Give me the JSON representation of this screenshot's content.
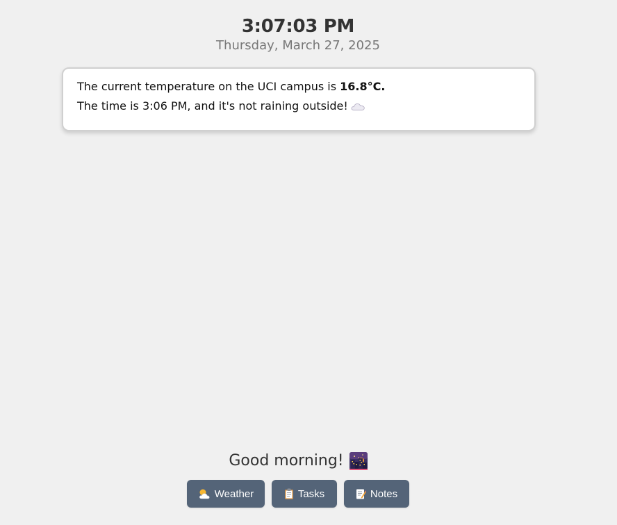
{
  "clock": {
    "time": "3:07:03 PM",
    "date": "Thursday, March 27, 2025"
  },
  "info_card": {
    "line1_prefix": "The current temperature on the UCI campus is ",
    "temperature": "16.8°C.",
    "line2": "The time is 3:06 PM, and it's not raining outside!",
    "weather_icon": "cloud-icon"
  },
  "greeting": {
    "text": "Good morning!",
    "icon": "night-city-icon"
  },
  "nav_buttons": [
    {
      "label": "Weather",
      "icon": "sun-behind-cloud-icon"
    },
    {
      "label": "Tasks",
      "icon": "clipboard-icon"
    },
    {
      "label": "Notes",
      "icon": "memo-icon"
    }
  ],
  "colors": {
    "background": "#f0f0f0",
    "button": "#546478",
    "card": "#ffffff"
  }
}
